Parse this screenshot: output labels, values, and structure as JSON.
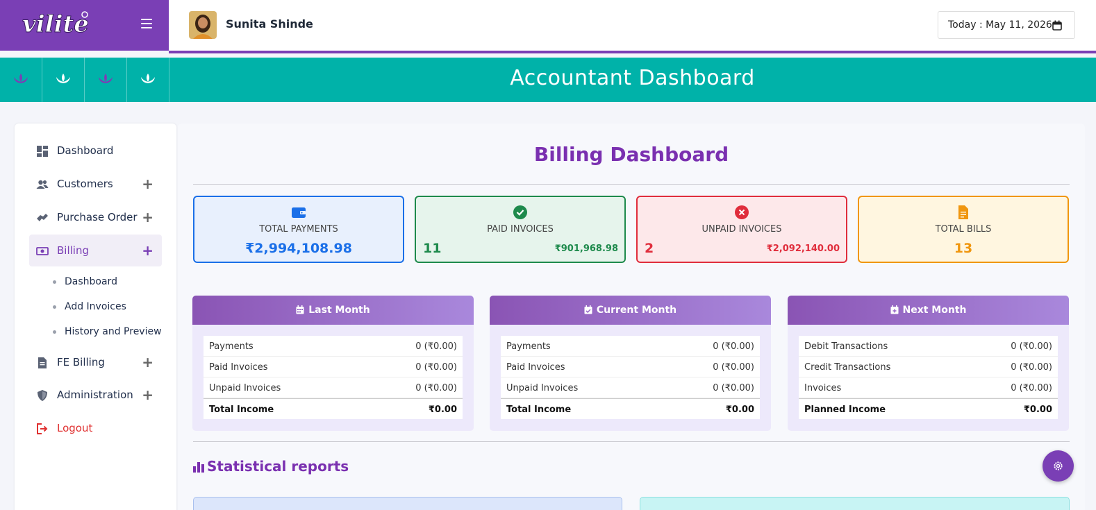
{
  "app": {
    "logo_text": "vilite",
    "user_name": "Sunita Shinde",
    "today_label": "Today : May 11, 2026"
  },
  "banner": {
    "title": "Accountant Dashboard"
  },
  "sidebar": {
    "items": [
      {
        "label": "Dashboard",
        "icon": "dashboard-icon",
        "expandable": false
      },
      {
        "label": "Customers",
        "icon": "users-icon",
        "expandable": true
      },
      {
        "label": "Purchase Order",
        "icon": "handshake-icon",
        "expandable": true
      },
      {
        "label": "Billing",
        "icon": "money-bill-icon",
        "expandable": true,
        "active": true
      },
      {
        "label": "FE Billing",
        "icon": "document-icon",
        "expandable": true
      },
      {
        "label": "Administration",
        "icon": "shield-icon",
        "expandable": true
      },
      {
        "label": "Logout",
        "icon": "logout-icon",
        "expandable": false
      }
    ],
    "billing_subitems": [
      "Dashboard",
      "Add Invoices",
      "History and Preview"
    ]
  },
  "main": {
    "title": "Billing Dashboard",
    "cards": [
      {
        "title": "TOTAL PAYMENTS",
        "value": "₹2,994,108.98",
        "icon": "wallet-icon",
        "color": "#1a6fe8"
      },
      {
        "title": "PAID INVOICES",
        "count": "11",
        "amount": "₹901,968.98",
        "icon": "check-circle-icon",
        "color": "#1e8a4c"
      },
      {
        "title": "UNPAID INVOICES",
        "count": "2",
        "amount": "₹2,092,140.00",
        "icon": "x-circle-icon",
        "color": "#e02d3c"
      },
      {
        "title": "TOTAL BILLS",
        "value": "13",
        "icon": "file-icon",
        "color": "#f0960e"
      }
    ],
    "panels": [
      {
        "title": "Last Month",
        "rows": [
          {
            "label": "Payments",
            "value": "0 (₹0.00)"
          },
          {
            "label": "Paid Invoices",
            "value": "0 (₹0.00)"
          },
          {
            "label": "Unpaid Invoices",
            "value": "0 (₹0.00)"
          }
        ],
        "total_label": "Total Income",
        "total_value": "₹0.00"
      },
      {
        "title": "Current Month",
        "rows": [
          {
            "label": "Payments",
            "value": "0 (₹0.00)"
          },
          {
            "label": "Paid Invoices",
            "value": "0 (₹0.00)"
          },
          {
            "label": "Unpaid Invoices",
            "value": "0 (₹0.00)"
          }
        ],
        "total_label": "Total Income",
        "total_value": "₹0.00"
      },
      {
        "title": "Next Month",
        "rows": [
          {
            "label": "Debit Transactions",
            "value": "0 (₹0.00)"
          },
          {
            "label": "Credit Transactions",
            "value": "0 (₹0.00)"
          },
          {
            "label": "Invoices",
            "value": "0 (₹0.00)"
          }
        ],
        "total_label": "Planned Income",
        "total_value": "₹0.00"
      }
    ],
    "stat_title": "Statistical reports"
  },
  "colors": {
    "brand_purple": "#7a3fb5",
    "banner_teal": "#00b2a9"
  }
}
